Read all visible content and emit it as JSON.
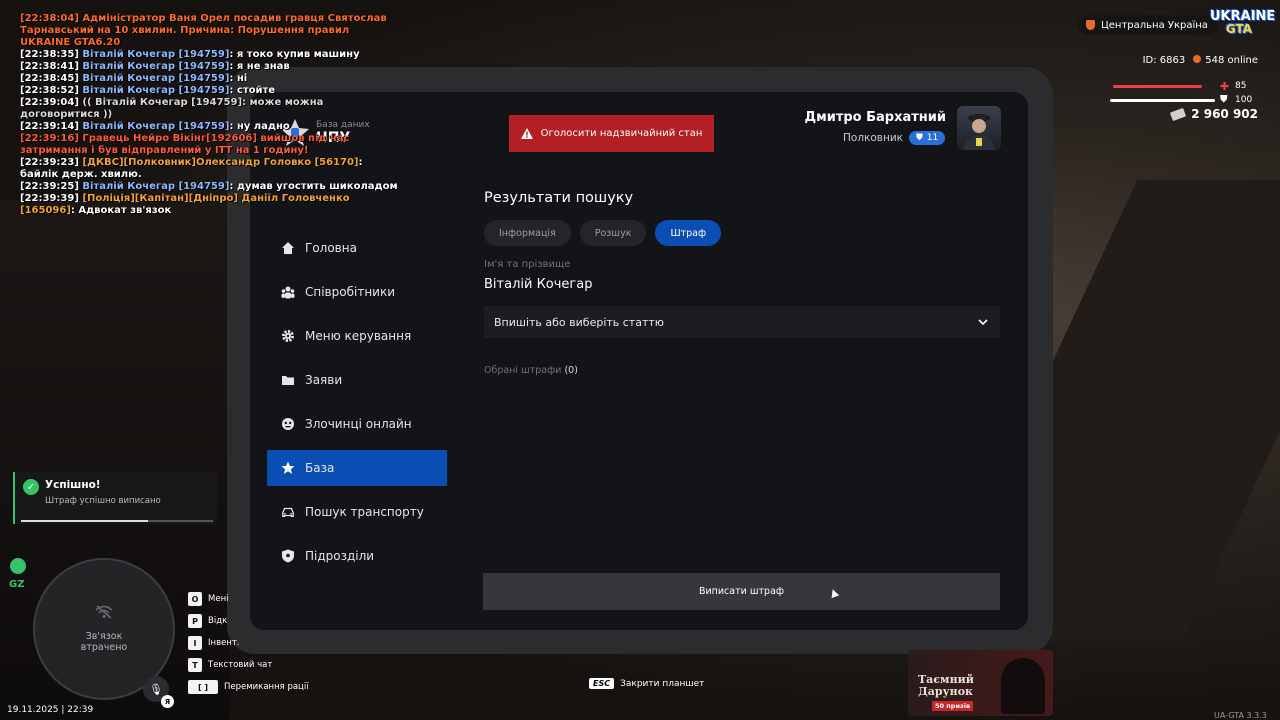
{
  "chat": [
    {
      "parts": [
        {
          "t": "[22:38:04] Адміністратор Ваня Орел посадив гравця Святослав Тарнавський на 10 хвилин. Причина: Порушення правил UKRAINE GTA6.20",
          "c": "c-admin"
        }
      ]
    },
    {
      "parts": [
        {
          "t": "[22:38:35] ",
          "c": "c-white"
        },
        {
          "t": "Віталій Кочегар [194759]",
          "c": "c-blue"
        },
        {
          "t": ": я токо купив машину",
          "c": "c-white"
        }
      ]
    },
    {
      "parts": [
        {
          "t": "[22:38:41] ",
          "c": "c-white"
        },
        {
          "t": "Віталій Кочегар [194759]",
          "c": "c-blue"
        },
        {
          "t": ": я не знав",
          "c": "c-white"
        }
      ]
    },
    {
      "parts": [
        {
          "t": "[22:38:45] ",
          "c": "c-white"
        },
        {
          "t": "Віталій Кочегар [194759]",
          "c": "c-blue"
        },
        {
          "t": ": ні",
          "c": "c-white"
        }
      ]
    },
    {
      "parts": [
        {
          "t": "[22:38:52] ",
          "c": "c-white"
        },
        {
          "t": "Віталій Кочегар [194759]",
          "c": "c-blue"
        },
        {
          "t": ": стойте",
          "c": "c-white"
        }
      ]
    },
    {
      "parts": [
        {
          "t": "[22:39:04] ",
          "c": "c-white"
        },
        {
          "t": "(( Віталій Кочегар [194759]: може можна договоритися ))",
          "c": "c-gray"
        }
      ]
    },
    {
      "parts": [
        {
          "t": "[22:39:14] ",
          "c": "c-white"
        },
        {
          "t": "Віталій Кочегар [194759]",
          "c": "c-blue"
        },
        {
          "t": ": ну ладно",
          "c": "c-white"
        }
      ]
    },
    {
      "parts": [
        {
          "t": "[22:39:16] Гравець Нейро Вікінг[192606] вийшов під час затримання і був відправлений у ІТТ на 1 годину!",
          "c": "c-red"
        }
      ]
    },
    {
      "parts": [
        {
          "t": "[22:39:23] ",
          "c": "c-white"
        },
        {
          "t": "[ДКВС][Полковник]Олександр Головко [56170]",
          "c": "c-orange"
        },
        {
          "t": ": байлік держ. хвилю.",
          "c": "c-white"
        }
      ]
    },
    {
      "parts": [
        {
          "t": "[22:39:25] ",
          "c": "c-white"
        },
        {
          "t": "Віталій Кочегар [194759]",
          "c": "c-blue"
        },
        {
          "t": ": думав угостить шиколадом",
          "c": "c-white"
        }
      ]
    },
    {
      "parts": [
        {
          "t": "[22:39:39] ",
          "c": "c-white"
        },
        {
          "t": "[Поліція][Капітан][Дніпро] Даніїл Головченко [165096]",
          "c": "c-orange"
        },
        {
          "t": ": Адвокат зв'язок",
          "c": "c-white"
        }
      ]
    }
  ],
  "hud": {
    "region": "Центральна Україна",
    "logo_top": "UKRAINE",
    "logo_bottom": "GTA",
    "id": "ID: 6863",
    "online": "548 online",
    "health": 85,
    "health_label": "85",
    "armor": 100,
    "armor_label": "100",
    "money": "2 960 902"
  },
  "tablet": {
    "brand_sub": "База даних",
    "brand_name": "НПУ",
    "alert_button": "Оголосити надзвичайний стан",
    "user_name": "Дмитро Бархатний",
    "user_rank": "Полковник",
    "rank_level": "11",
    "sidebar": [
      {
        "label": "Головна",
        "icon": "home-icon",
        "active": false
      },
      {
        "label": "Співробітники",
        "icon": "employees-icon",
        "active": false
      },
      {
        "label": "Меню керування",
        "icon": "gear-icon",
        "active": false
      },
      {
        "label": "Заяви",
        "icon": "folder-icon",
        "active": false
      },
      {
        "label": "Злочинці онлайн",
        "icon": "mask-icon",
        "active": false
      },
      {
        "label": "База",
        "icon": "star-icon",
        "active": true
      },
      {
        "label": "Пошук транспорту",
        "icon": "car-icon",
        "active": false
      },
      {
        "label": "Підрозділи",
        "icon": "shield-icon",
        "active": false
      }
    ],
    "results_title": "Результати пошуку",
    "tabs": [
      {
        "label": "Інформація",
        "active": false
      },
      {
        "label": "Розшук",
        "active": false
      },
      {
        "label": "Штраф",
        "active": true
      }
    ],
    "fio_label": "Ім'я та прізвище",
    "fio_value": "Віталій Кочегар",
    "article_select": "Впишіть або виберіть статтю",
    "selected_fines_label": "Обрані штрафи",
    "selected_fines_count": "(0)",
    "submit_button": "Виписати штраф",
    "close_key": "ESC",
    "close_label": "Закрити планшет"
  },
  "notification": {
    "title": "Успішно!",
    "desc": "Штраф успішно виписано",
    "progress": 0.66
  },
  "minimap": {
    "zone": "GZ",
    "lost_line1": "Зв'язок",
    "lost_line2": "втрачено",
    "voice_key": "Я",
    "datetime": "19.11.2025 | 22:39"
  },
  "hotkeys": [
    {
      "key": "O",
      "label": "Мені"
    },
    {
      "key": "P",
      "label": "Відк"
    },
    {
      "key": "I",
      "label": "Інвент."
    },
    {
      "key": "T",
      "label": "Текстовий чат"
    },
    {
      "key": "[ ]",
      "label": "Перемикання рації"
    }
  ],
  "promo": {
    "line1": "Таємний",
    "line2": "Дарунок",
    "badge": "50 призів"
  },
  "version": "UA-GTA 3.3.3",
  "colors": {
    "accent": "#0b4eb3",
    "danger": "#b21f24",
    "success": "#35c46a"
  }
}
